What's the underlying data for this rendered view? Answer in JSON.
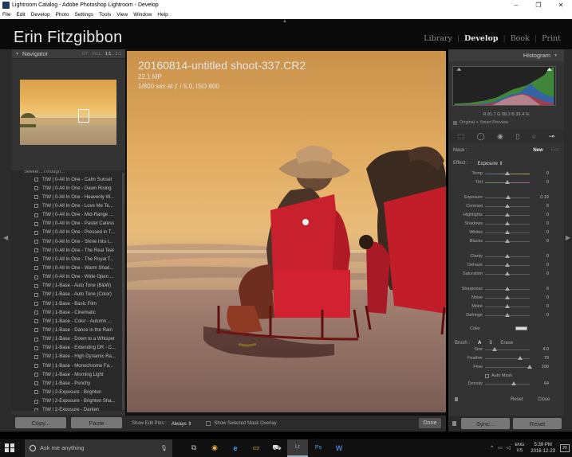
{
  "window": {
    "title": "Lightroom Catalog - Adobe Photoshop Lightroom - Develop",
    "controls": [
      "–",
      "❐",
      "✕"
    ]
  },
  "menu": [
    "File",
    "Edit",
    "Develop",
    "Photo",
    "Settings",
    "Tools",
    "View",
    "Window",
    "Help"
  ],
  "identity": {
    "plate": "Erin Fitzgibbon",
    "modules": [
      "Library",
      "Develop",
      "Book",
      "Print"
    ],
    "active_module": "Develop"
  },
  "navigator": {
    "title": "Navigator",
    "zoom": [
      "FIT",
      "FILL",
      "1:1",
      "3:1"
    ]
  },
  "presets": {
    "group_cut": "Seeker...Through...",
    "items": [
      "TtW | 0-All In One - Calm Sunset",
      "TtW | 0-All In One - Dawn Rising",
      "TtW | 0-All In One - Heavenly W...",
      "TtW | 0-All In One - Love Me Te...",
      "TtW | 0-All In One - Mid-Range ...",
      "TtW | 0-All In One - Pastel Caress",
      "TtW | 0-All In One - Pressed in T...",
      "TtW | 0-All In One - Shine Into t...",
      "TtW | 0-All In One - The Real Teal",
      "TtW | 0-All In One - The Royal T...",
      "TtW | 0-All In One - Warm Shad...",
      "TtW | 0-All In One - Wide Open ...",
      "TtW | 1-Base - Auto Tone (B&W)",
      "TtW | 1-Base - Auto Tone (Color)",
      "TtW | 1-Base - Basic Film",
      "TtW | 1-Base - Cinematic",
      "TtW | 1-Base - Color - Autumn ...",
      "TtW | 1-Base - Dance in the Rain",
      "TtW | 1-Base - Down to a Whisper",
      "TtW | 1-Base - Extending DR - C...",
      "TtW | 1-Base - High Dynamic Ra...",
      "TtW | 1-Base - Monochrome Fa...",
      "TtW | 1-Base - Morning Light",
      "TtW | 1-Base - Punchy",
      "TtW | 2-Exposure - Brighten",
      "TtW | 2-Exposure - Brighten Sha...",
      "TtW | 2-Exposure - Darken"
    ]
  },
  "left_buttons": {
    "copy": "Copy...",
    "paste": "Paste"
  },
  "photo_info": {
    "filename": "20160814-untitled shoot-337.CR2",
    "megapixels": "22.1 MP",
    "exposure": "1/800 sec at ƒ / 5.0, ISO 800"
  },
  "toolbar": {
    "show_edit_pins_label": "Show Edit Pins :",
    "show_edit_pins_value": "Always ⇕",
    "overlay_label": "Show Selected Mask Overlay",
    "done": "Done"
  },
  "histogram": {
    "title": "Histogram",
    "rgb": "R  81.7   G  58.3   B  39.4  %",
    "sub": "Original + Smart Preview"
  },
  "mask": {
    "label": "Mask :",
    "new": "New",
    "edit": "Edit"
  },
  "effect": {
    "label": "Effect :",
    "value": "Exposure ⇕"
  },
  "sliders": [
    {
      "label": "Temp",
      "value": "0",
      "pos": 0.5
    },
    {
      "label": "Tint",
      "value": "0",
      "pos": 0.5
    },
    {
      "label": "Exposure",
      "value": "0.19",
      "pos": 0.52
    },
    {
      "label": "Contrast",
      "value": "0",
      "pos": 0.5
    },
    {
      "label": "Highlights",
      "value": "0",
      "pos": 0.5
    },
    {
      "label": "Shadows",
      "value": "0",
      "pos": 0.5
    },
    {
      "label": "Whites",
      "value": "0",
      "pos": 0.5
    },
    {
      "label": "Blacks",
      "value": "0",
      "pos": 0.5
    },
    {
      "label": "Clarity",
      "value": "0",
      "pos": 0.5
    },
    {
      "label": "Dehaze",
      "value": "0",
      "pos": 0.5
    },
    {
      "label": "Saturation",
      "value": "0",
      "pos": 0.5
    },
    {
      "label": "Sharpness",
      "value": "0",
      "pos": 0.5
    },
    {
      "label": "Noise",
      "value": "0",
      "pos": 0.5
    },
    {
      "label": "Moiré",
      "value": "0",
      "pos": 0.5
    },
    {
      "label": "Defringe",
      "value": "0",
      "pos": 0.5
    }
  ],
  "color_label": "Color",
  "brush": {
    "label": "Brush :",
    "a": "A",
    "b": "B",
    "erase": "Erase",
    "sliders": [
      {
        "label": "Size",
        "value": "4.0",
        "pos": 0.22
      },
      {
        "label": "Feather",
        "value": "79",
        "pos": 0.79
      },
      {
        "label": "Flow",
        "value": "100",
        "pos": 1.0
      }
    ],
    "auto_mask": "Auto Mask",
    "density": {
      "label": "Density",
      "value": "64",
      "pos": 0.64
    }
  },
  "panel_end": {
    "reset": "Reset",
    "close": "Close"
  },
  "right_buttons": {
    "sync": "Sync...",
    "reset": "Reset"
  },
  "taskbar": {
    "search": "Ask me anything",
    "apps": [
      "⧉",
      "◉",
      "e",
      "▭",
      "⛟",
      "Lr",
      "Ps",
      "W"
    ],
    "lang_top": "ENG",
    "lang_bottom": "US",
    "time": "5:39 PM",
    "date": "2016-12-23",
    "notifications": "20"
  }
}
